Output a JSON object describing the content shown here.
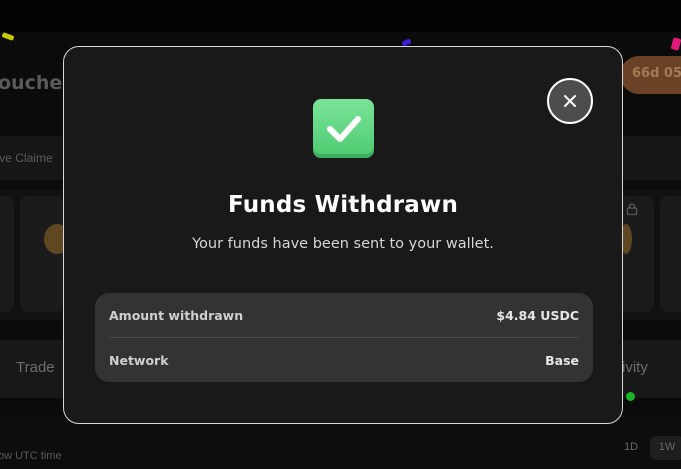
{
  "background": {
    "page_title_fragment": "oucher",
    "countdown_fragment": "66d 05",
    "claimed_fragment": "'ve Claime",
    "tabs": {
      "trade": "Trade",
      "activity_fragment": "ivity"
    },
    "utc_fragment": "ow UTC time",
    "ranges": [
      "1D",
      "1W"
    ]
  },
  "modal": {
    "icon": "check-mark-icon",
    "title": "Funds Withdrawn",
    "subtitle": "Your funds have been sent to your wallet.",
    "details": [
      {
        "label": "Amount withdrawn",
        "value": "$4.84 USDC"
      },
      {
        "label": "Network",
        "value": "Base"
      }
    ],
    "close_icon": "close-icon"
  },
  "colors": {
    "success": "#4ecb72",
    "modal_bg": "#191919",
    "details_bg": "#333333",
    "accent_timer": "#6a4226"
  }
}
